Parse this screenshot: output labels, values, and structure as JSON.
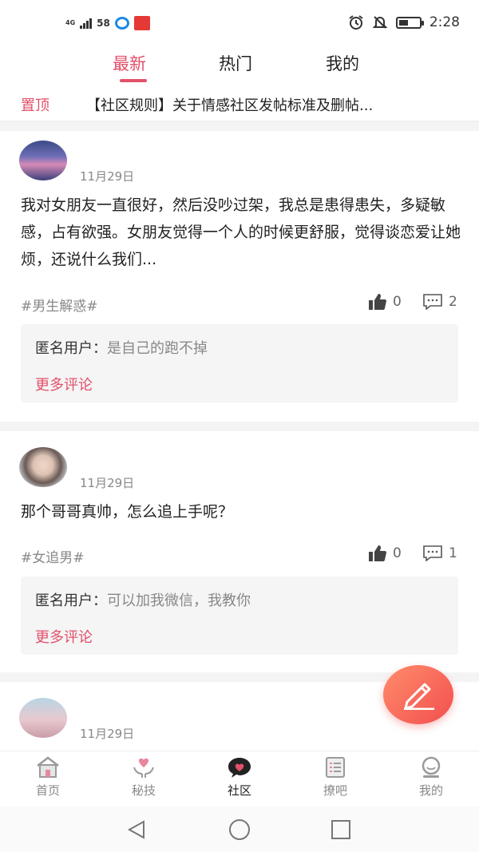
{
  "status_bar": {
    "network": "4G",
    "app_badge": "58",
    "time": "2:28"
  },
  "tabs": [
    {
      "label": "最新",
      "active": true
    },
    {
      "label": "热门",
      "active": false
    },
    {
      "label": "我的",
      "active": false
    }
  ],
  "pinned": {
    "tag": "置顶",
    "title": "【社区规则】关于情感社区发帖标准及删帖..."
  },
  "posts": [
    {
      "date": "11月29日",
      "content": "我对女朋友一直很好，然后没吵过架，我总是患得患失，多疑敏感，占有欲强。女朋友觉得一个人的时候更舒服，觉得谈恋爱让她烦，还说什么我们...",
      "topic": "#男生解惑#",
      "likes": "0",
      "comments_count": "2",
      "comment_user": "匿名用户：",
      "comment_text": "是自己的跑不掉",
      "more_label": "更多评论"
    },
    {
      "date": "11月29日",
      "content": "那个哥哥真帅，怎么追上手呢？",
      "topic": "#女追男#",
      "likes": "0",
      "comments_count": "1",
      "comment_user": "匿名用户：",
      "comment_text": "可以加我微信，我教你",
      "more_label": "更多评论"
    },
    {
      "date": "11月29日"
    }
  ],
  "bottom_nav": [
    {
      "label": "首页",
      "icon": "home-icon"
    },
    {
      "label": "秘技",
      "icon": "heart-hands-icon"
    },
    {
      "label": "社区",
      "icon": "chat-heart-icon",
      "active": true
    },
    {
      "label": "撩吧",
      "icon": "list-icon"
    },
    {
      "label": "我的",
      "icon": "profile-icon"
    }
  ],
  "colors": {
    "accent": "#e2506a",
    "fab_start": "#ff8c6a",
    "fab_end": "#f24f4f"
  }
}
